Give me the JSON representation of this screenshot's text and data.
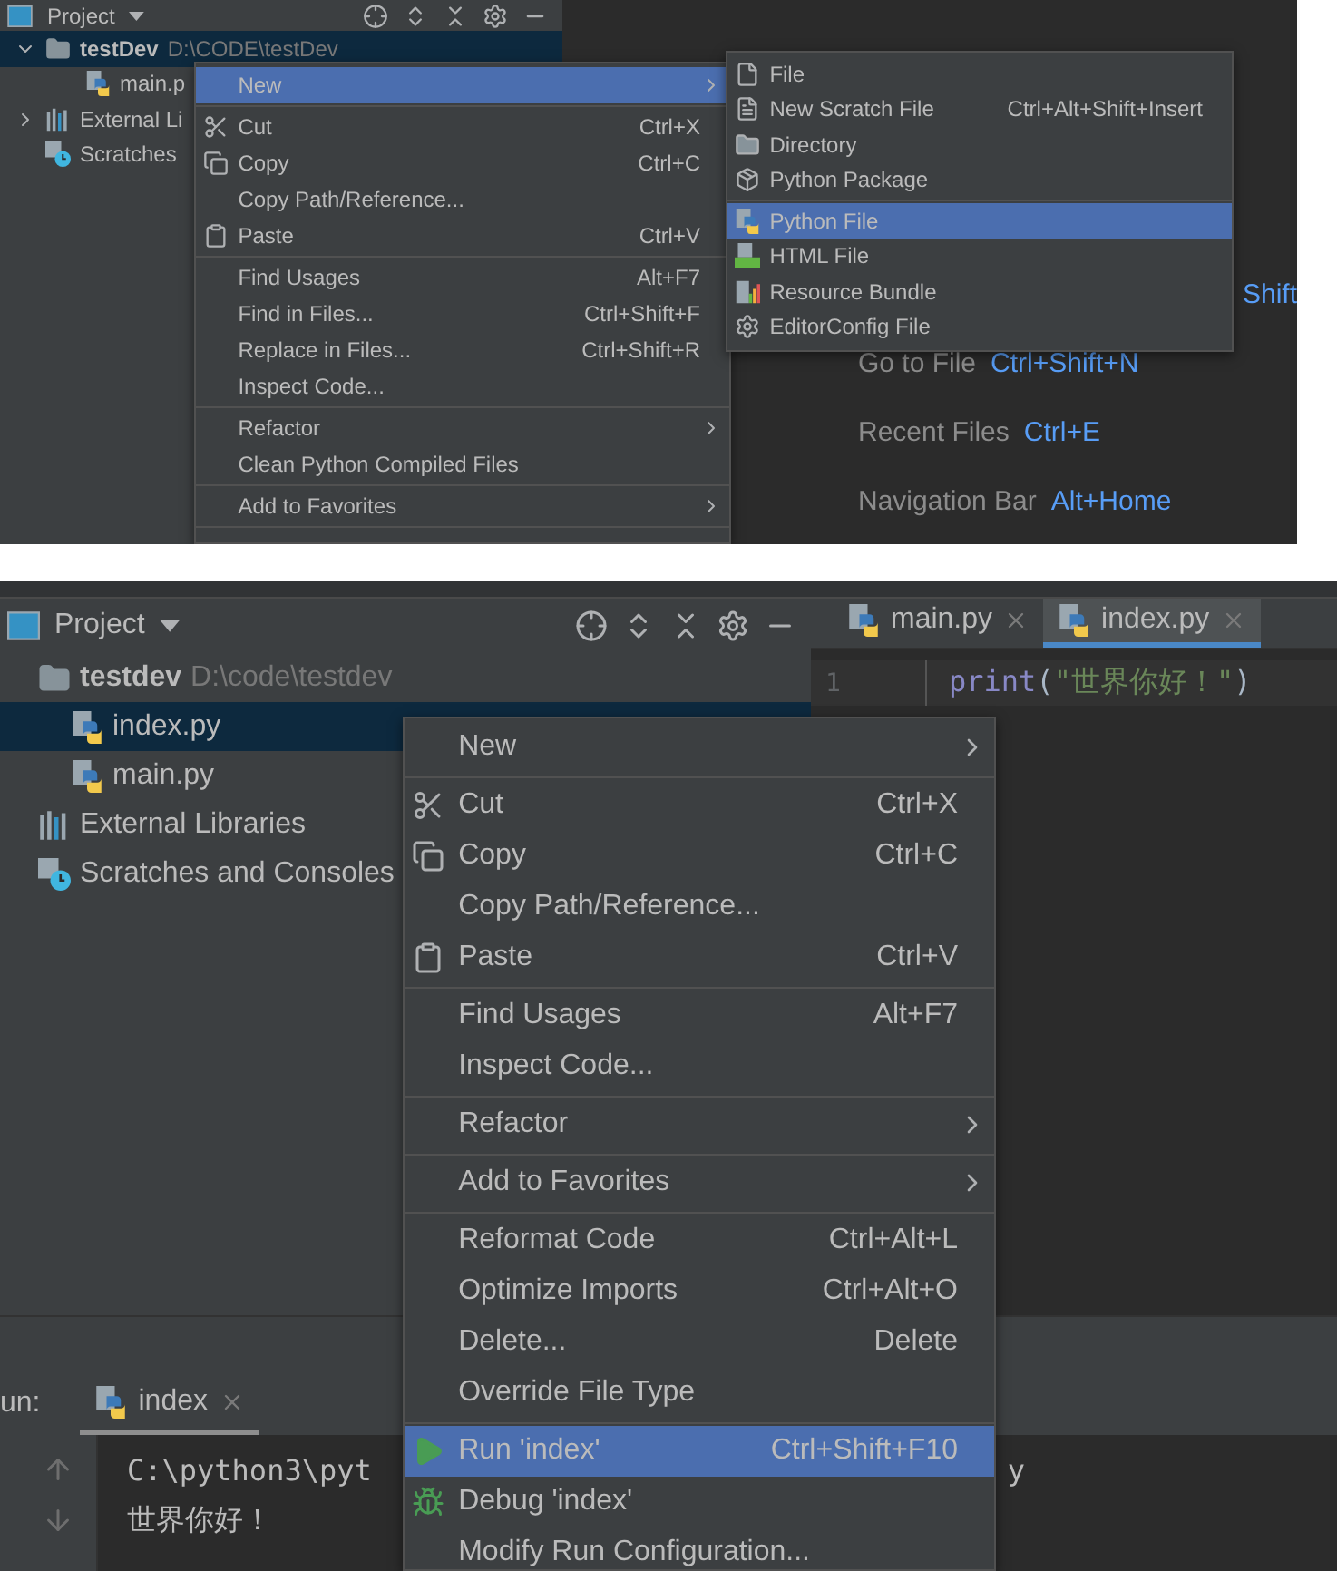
{
  "top_screenshot": {
    "project_header": {
      "title": "Project"
    },
    "tree": [
      {
        "kind": "folder",
        "label": "testDev",
        "path": "D:\\CODE\\testDev",
        "expanded": true,
        "selected": true,
        "children": [
          {
            "kind": "python",
            "label": "main.p",
            "selected": false
          }
        ]
      },
      {
        "kind": "libraries",
        "label": "External Li",
        "expanded": false,
        "selected": false
      },
      {
        "kind": "scratches",
        "label": "Scratches",
        "selected": false
      }
    ],
    "context_menu": [
      {
        "kind": "item",
        "label": "New",
        "has_submenu": true,
        "selected": true
      },
      {
        "kind": "separator"
      },
      {
        "kind": "item",
        "label": "Cut",
        "shortcut": "Ctrl+X",
        "selected": false
      },
      {
        "kind": "item",
        "label": "Copy",
        "shortcut": "Ctrl+C",
        "selected": false
      },
      {
        "kind": "item",
        "label": "Copy Path/Reference...",
        "selected": false
      },
      {
        "kind": "item",
        "label": "Paste",
        "shortcut": "Ctrl+V",
        "selected": false
      },
      {
        "kind": "separator"
      },
      {
        "kind": "item",
        "label": "Find Usages",
        "shortcut": "Alt+F7",
        "selected": false
      },
      {
        "kind": "item",
        "label": "Find in Files...",
        "shortcut": "Ctrl+Shift+F",
        "selected": false
      },
      {
        "kind": "item",
        "label": "Replace in Files...",
        "shortcut": "Ctrl+Shift+R",
        "selected": false
      },
      {
        "kind": "item",
        "label": "Inspect Code...",
        "selected": false
      },
      {
        "kind": "separator"
      },
      {
        "kind": "item",
        "label": "Refactor",
        "has_submenu": true,
        "selected": false
      },
      {
        "kind": "item",
        "label": "Clean Python Compiled Files",
        "selected": false
      },
      {
        "kind": "separator"
      },
      {
        "kind": "item",
        "label": "Add to Favorites",
        "has_submenu": true,
        "selected": false
      },
      {
        "kind": "separator"
      }
    ],
    "new_submenu": [
      {
        "kind": "item",
        "label": "File",
        "selected": false
      },
      {
        "kind": "item",
        "label": "New Scratch File",
        "shortcut": "Ctrl+Alt+Shift+Insert",
        "selected": false
      },
      {
        "kind": "item",
        "label": "Directory",
        "selected": false
      },
      {
        "kind": "item",
        "label": "Python Package",
        "selected": false
      },
      {
        "kind": "separator"
      },
      {
        "kind": "item",
        "label": "Python File",
        "selected": true
      },
      {
        "kind": "item",
        "label": "HTML File",
        "selected": false
      },
      {
        "kind": "item",
        "label": "Resource Bundle",
        "selected": false
      },
      {
        "kind": "item",
        "label": "EditorConfig File",
        "selected": false
      }
    ],
    "welcome_hints": [
      {
        "shortcut": "Shift"
      },
      {
        "label": "Go to File",
        "shortcut": "Ctrl+Shift+N"
      },
      {
        "label": "Recent Files",
        "shortcut": "Ctrl+E"
      },
      {
        "label": "Navigation Bar",
        "shortcut": "Alt+Home"
      }
    ]
  },
  "bottom_screenshot": {
    "project_header": {
      "title": "Project"
    },
    "tree": [
      {
        "kind": "folder",
        "label": "testdev",
        "path": "D:\\code\\testdev",
        "selected": false,
        "children": [
          {
            "kind": "python",
            "label": "index.py",
            "selected": true
          },
          {
            "kind": "python",
            "label": "main.py",
            "selected": false
          }
        ]
      },
      {
        "kind": "libraries",
        "label": "External Libraries",
        "selected": false
      },
      {
        "kind": "scratches",
        "label": "Scratches and Consoles",
        "selected": false
      }
    ],
    "editor_tabs": [
      {
        "label": "main.py",
        "selected": false
      },
      {
        "label": "index.py",
        "selected": true
      }
    ],
    "editor_lines": [
      {
        "number": "1",
        "tokens": [
          {
            "kind": "function",
            "text": "print"
          },
          {
            "kind": "punct",
            "text": "("
          },
          {
            "kind": "string",
            "text": "\"世界你好！\""
          },
          {
            "kind": "punct",
            "text": ")"
          }
        ]
      }
    ],
    "context_menu": [
      {
        "kind": "item",
        "label": "New",
        "has_submenu": true,
        "selected": false
      },
      {
        "kind": "separator"
      },
      {
        "kind": "item",
        "label": "Cut",
        "shortcut": "Ctrl+X",
        "selected": false
      },
      {
        "kind": "item",
        "label": "Copy",
        "shortcut": "Ctrl+C",
        "selected": false
      },
      {
        "kind": "item",
        "label": "Copy Path/Reference...",
        "selected": false
      },
      {
        "kind": "item",
        "label": "Paste",
        "shortcut": "Ctrl+V",
        "selected": false
      },
      {
        "kind": "separator"
      },
      {
        "kind": "item",
        "label": "Find Usages",
        "shortcut": "Alt+F7",
        "selected": false
      },
      {
        "kind": "item",
        "label": "Inspect Code...",
        "selected": false
      },
      {
        "kind": "separator"
      },
      {
        "kind": "item",
        "label": "Refactor",
        "has_submenu": true,
        "selected": false
      },
      {
        "kind": "separator"
      },
      {
        "kind": "item",
        "label": "Add to Favorites",
        "has_submenu": true,
        "selected": false
      },
      {
        "kind": "separator"
      },
      {
        "kind": "item",
        "label": "Reformat Code",
        "shortcut": "Ctrl+Alt+L",
        "selected": false
      },
      {
        "kind": "item",
        "label": "Optimize Imports",
        "shortcut": "Ctrl+Alt+O",
        "selected": false
      },
      {
        "kind": "item",
        "label": "Delete...",
        "shortcut": "Delete",
        "selected": false
      },
      {
        "kind": "item",
        "label": "Override File Type",
        "selected": false
      },
      {
        "kind": "separator"
      },
      {
        "kind": "item",
        "label": "Run 'index'",
        "shortcut": "Ctrl+Shift+F10",
        "selected": true
      },
      {
        "kind": "item",
        "label": "Debug 'index'",
        "selected": false
      },
      {
        "kind": "item",
        "label": "Modify Run Configuration...",
        "selected": false
      }
    ],
    "run_panel": {
      "label": "un:",
      "tabs": [
        {
          "label": "index",
          "selected": true
        }
      ],
      "output": [
        {
          "parts": [
            "C:\\python3\\pyt",
            "y"
          ]
        },
        {
          "parts": [
            "世界你好！"
          ]
        }
      ]
    }
  }
}
